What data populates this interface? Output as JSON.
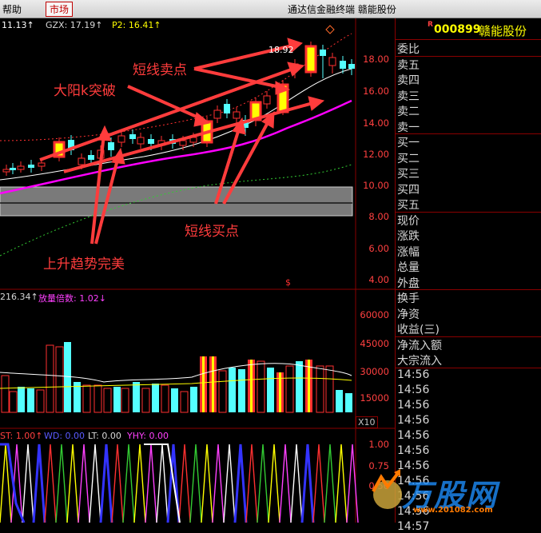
{
  "menubar": {
    "help": "帮助",
    "market": "市场",
    "title": "通达信金融终端  赣能股份"
  },
  "chart": {
    "ma_legend": {
      "m1": "11.13↑",
      "gzx": "GZX: 17.19↑",
      "p2": "P2: 16.41↑"
    },
    "high_label": "18.92",
    "price_axis": [
      "18.00",
      "16.00",
      "14.00",
      "12.00",
      "10.00",
      "8.00",
      "6.00",
      "4.00"
    ],
    "annotations": {
      "short_sell": "短线卖点",
      "big_yang": "大阳k突破",
      "short_buy": "短线买点",
      "uptrend": "上升趋势完美"
    },
    "dollar_mark": "$"
  },
  "volume": {
    "legend_left": "216.34↑",
    "legend_ratio": "放量倍数: 1.02↓",
    "axis": [
      "60000",
      "45000",
      "30000",
      "15000"
    ],
    "unit": "X10"
  },
  "indicator": {
    "st": "ST: 1.00↑",
    "wd": "WD: 0.00",
    "lt": "LT: 0.00",
    "yhy": "YHY: 0.00",
    "axis": [
      "1.00",
      "0.75",
      "0.50"
    ]
  },
  "panel": {
    "stock_r": "R",
    "stock_code": "000899",
    "stock_name": "赣能股份",
    "order_rows": [
      "委比",
      "卖五",
      "卖四",
      "卖三",
      "卖二",
      "卖一",
      "买一",
      "买二",
      "买三",
      "买四",
      "买五"
    ],
    "quote_rows": [
      "现价",
      "涨跌",
      "涨幅",
      "总量",
      "外盘",
      "换手",
      "净资",
      "收益(三)",
      "净流入额",
      "大宗流入"
    ],
    "times": [
      "14:56",
      "14:56",
      "14:56",
      "14:56",
      "14:56",
      "14:56",
      "14:56",
      "14:56",
      "14:56",
      "14:56",
      "14:57"
    ]
  },
  "watermark": {
    "brand": "万股网",
    "url": "www.201082.com"
  },
  "colors": {
    "up": "#ff3030",
    "down": "#54ffff",
    "big_yang_fill": "#ffff00",
    "ma_magenta": "#ff00ff",
    "arrow": "#ff3c3c"
  }
}
